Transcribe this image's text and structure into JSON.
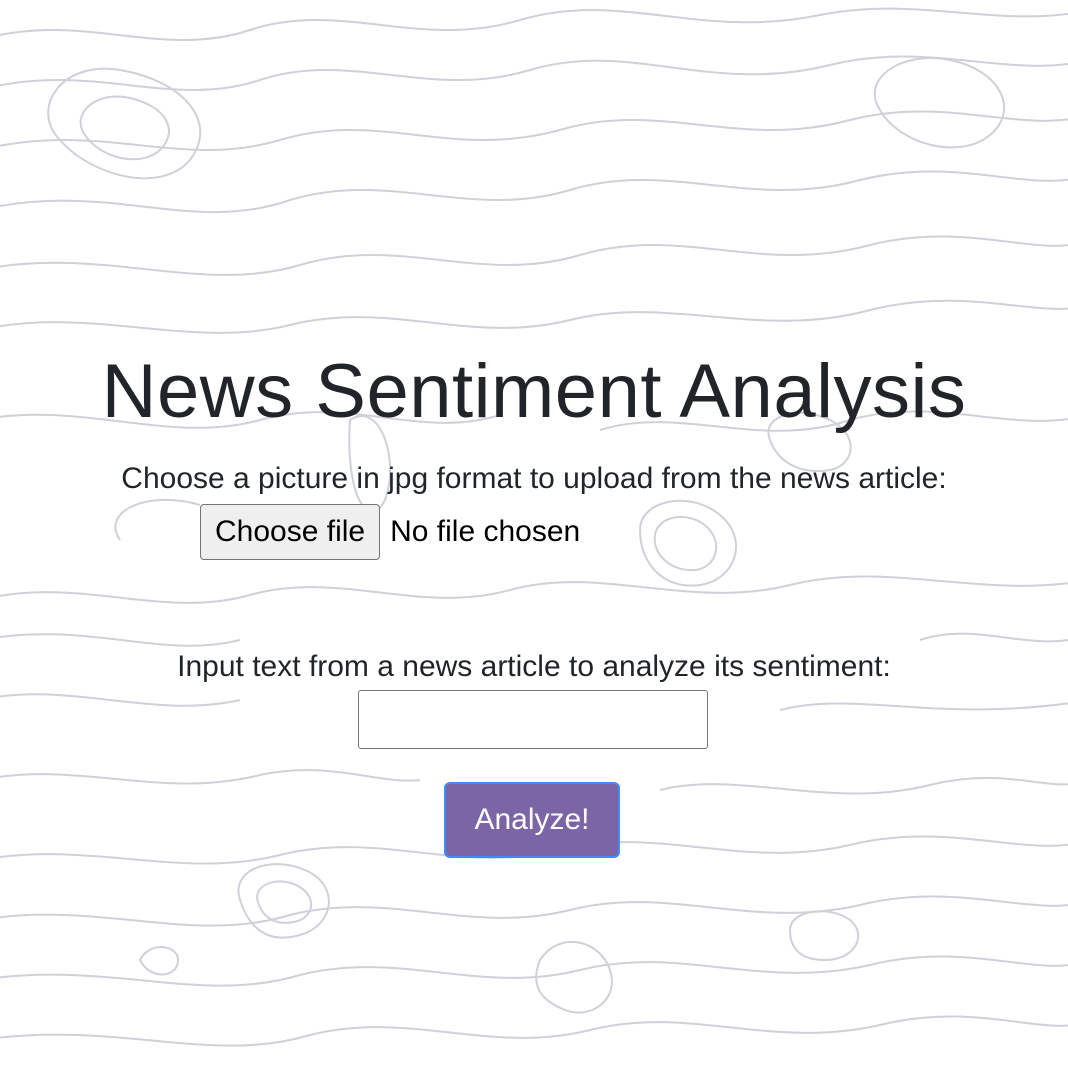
{
  "header": {
    "title": "News Sentiment Analysis"
  },
  "upload": {
    "label": "Choose a picture in jpg format to upload from the news article:",
    "button_label": "Choose file",
    "status": "No file chosen"
  },
  "text_input": {
    "label": "Input text from a news article to analyze its sentiment:",
    "value": "",
    "placeholder": ""
  },
  "actions": {
    "analyze_label": "Analyze!"
  },
  "colors": {
    "background": "#ffffff",
    "topo_lines": "#cfd0d8",
    "title_text": "#212529",
    "analyze_button_bg": "#7b65a6",
    "analyze_button_border": "#3d8bfd"
  }
}
